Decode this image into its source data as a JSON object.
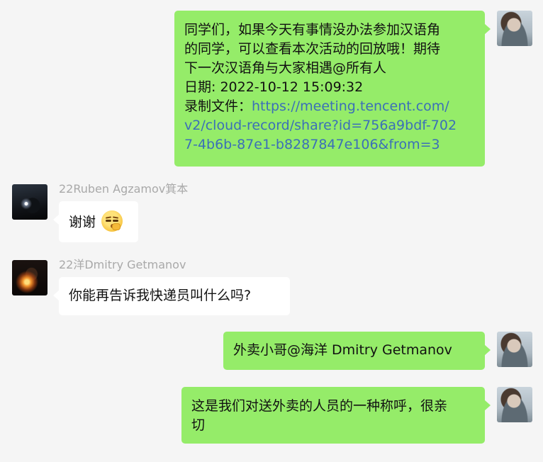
{
  "messages": [
    {
      "sender": "me",
      "lines": [
        "同学们，如果今天有事情没办法参加汉语角",
        "的同学，可以查看本次活动的回放哦！期待",
        "下一次汉语角与大家相遇@所有人",
        "日期: 2022-10-12 15:09:32"
      ],
      "link_label": "录制文件：",
      "link_lines": [
        "https://meeting.tencent.com/",
        "v2/cloud-record/share?id=756a9bdf-702",
        "7-4b6b-87e1-b8287847e106&from=3"
      ]
    },
    {
      "sender": "22Ruben Agzamov箕本",
      "text": "谢谢",
      "emoji": "thinking-face-emoji"
    },
    {
      "sender": "22洋Dmitry Getmanov",
      "text": "你能再告诉我快递员叫什么吗?"
    },
    {
      "sender": "me",
      "text": "外卖小哥@海洋 Dmitry Getmanov"
    },
    {
      "sender": "me",
      "lines": [
        "这是我们对送外卖的人员的一种称呼，很亲",
        "切"
      ]
    }
  ],
  "colors": {
    "background": "#f5f5f5",
    "outgoing_bubble": "#95ec69",
    "incoming_bubble": "#ffffff",
    "link": "#3b6fb8",
    "nickname": "#a9a9a9"
  }
}
